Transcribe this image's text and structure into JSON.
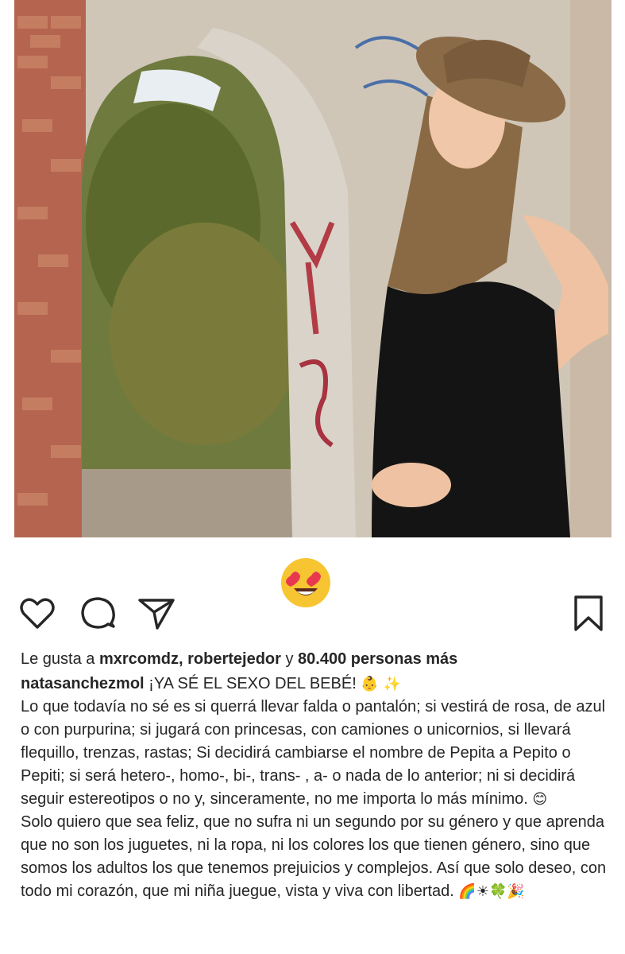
{
  "post": {
    "photo_description_icon": "photo-icon",
    "reaction_emoji": "heart-eyes-emoji"
  },
  "actions": {
    "like_icon": "heart-icon",
    "comment_icon": "comment-icon",
    "share_icon": "share-icon",
    "save_icon": "bookmark-icon"
  },
  "likes": {
    "prefix": "Le gusta a ",
    "users": "mxrcomdz, robertejedor",
    "middle": " y ",
    "count": "80.400 personas más"
  },
  "caption": {
    "username": "natasanchezmol",
    "headline": " ¡YA SÉ EL SEXO DEL BEBÉ! ",
    "headline_emojis": "👶 ✨",
    "paragraph1": "Lo que todavía no sé es si querrá llevar falda o pantalón; si vestirá de rosa, de azul o con purpurina; si jugará con princesas, con camiones o unicornios, si llevará flequillo, trenzas, rastas; Si decidirá cambiarse el nombre de Pepita a Pepito o Pepiti; si será hetero-, homo-, bi-, trans- , a- o nada de lo anterior; ni si decidirá seguir estereotipos o no y, sinceramente, no me importa lo más mínimo. ",
    "paragraph1_emoji": "😊",
    "paragraph2": "Solo quiero que sea feliz, que no sufra ni un segundo por su género y que aprenda que no son los juguetes, ni la ropa, ni los colores los que tienen género, sino que somos los adultos los que tenemos prejuicios y complejos. Así que solo deseo, con todo mi corazón, que mi niña juegue, vista y viva con libertad. ",
    "paragraph2_emojis": "🌈☀🍀🎉"
  },
  "colors": {
    "text": "#262626",
    "icon_stroke": "#262626",
    "emoji_face": "#f7c531",
    "heart": "#e8384f"
  }
}
